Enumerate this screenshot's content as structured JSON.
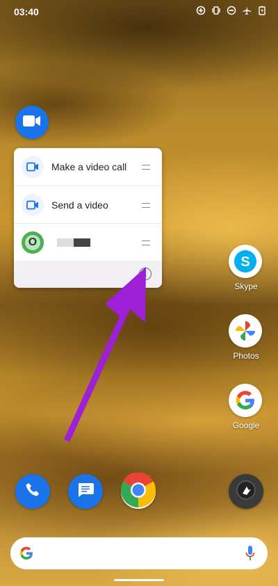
{
  "status_bar": {
    "time": "03:40",
    "icons": [
      "data-saver-icon",
      "vibrate-icon",
      "do-not-disturb-icon",
      "airplane-icon",
      "battery-charging-icon"
    ]
  },
  "app_shortcut_source": {
    "icon": "video-camera-icon",
    "app": "Duo"
  },
  "shortcut_menu": {
    "items": [
      {
        "label": "Make a video call",
        "icon": "video-camera-icon"
      },
      {
        "label": "Send a video",
        "icon": "video-camera-icon"
      },
      {
        "label": "",
        "avatar_letter": "O",
        "redacted": true
      }
    ],
    "footer": {
      "icon": "info-icon",
      "glyph": "i"
    }
  },
  "annotation": {
    "type": "arrow",
    "color": "#9d1fd6",
    "points_to": "info-icon"
  },
  "home_apps": [
    {
      "label": "Skype",
      "icon": "skype-icon"
    },
    {
      "label": "Photos",
      "icon": "photos-pinwheel-icon"
    },
    {
      "label": "Google",
      "icon": "google-g-icon"
    }
  ],
  "dock": [
    {
      "icon": "phone-icon",
      "color": "#1a73e8"
    },
    {
      "icon": "messages-icon",
      "color": "#1a73e8"
    },
    {
      "icon": "chrome-icon"
    },
    {
      "icon": "app-icon",
      "color": "#333333"
    }
  ],
  "search_bar": {
    "left_icon": "google-g-icon",
    "right_icon": "microphone-icon"
  },
  "colors": {
    "accent": "#1a73e8",
    "arrow": "#9d1fd6"
  }
}
